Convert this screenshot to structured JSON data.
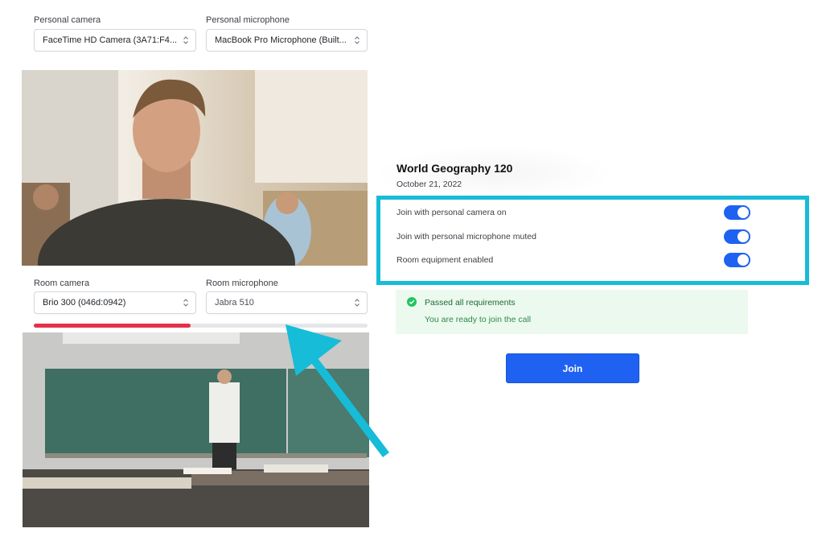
{
  "personal": {
    "camera_label": "Personal camera",
    "camera_value": "FaceTime HD Camera (3A71:F4...",
    "mic_label": "Personal microphone",
    "mic_value": "MacBook Pro Microphone (Built..."
  },
  "room": {
    "camera_label": "Room camera",
    "camera_value": "Brio 300 (046d:0942)",
    "mic_label": "Room microphone",
    "mic_value": "Jabra 510",
    "mic_level_fraction": 0.47
  },
  "meeting": {
    "title": "World Geography 120",
    "date": "October 21, 2022"
  },
  "options": [
    {
      "label": "Join with personal camera on",
      "on": true
    },
    {
      "label": "Join with personal microphone muted",
      "on": true
    },
    {
      "label": "Room equipment enabled",
      "on": true
    }
  ],
  "requirements": {
    "title": "Passed all requirements",
    "subtitle": "You are ready to join the call"
  },
  "join_label": "Join",
  "colors": {
    "accent": "#1f62f2",
    "highlight": "#16bcd8",
    "meter": "#e5304a",
    "success_bg": "#ecf9ef",
    "success_icon": "#22c55e"
  },
  "icons": {
    "select": "chevron-updown-icon",
    "requirements": "check-circle-icon"
  }
}
